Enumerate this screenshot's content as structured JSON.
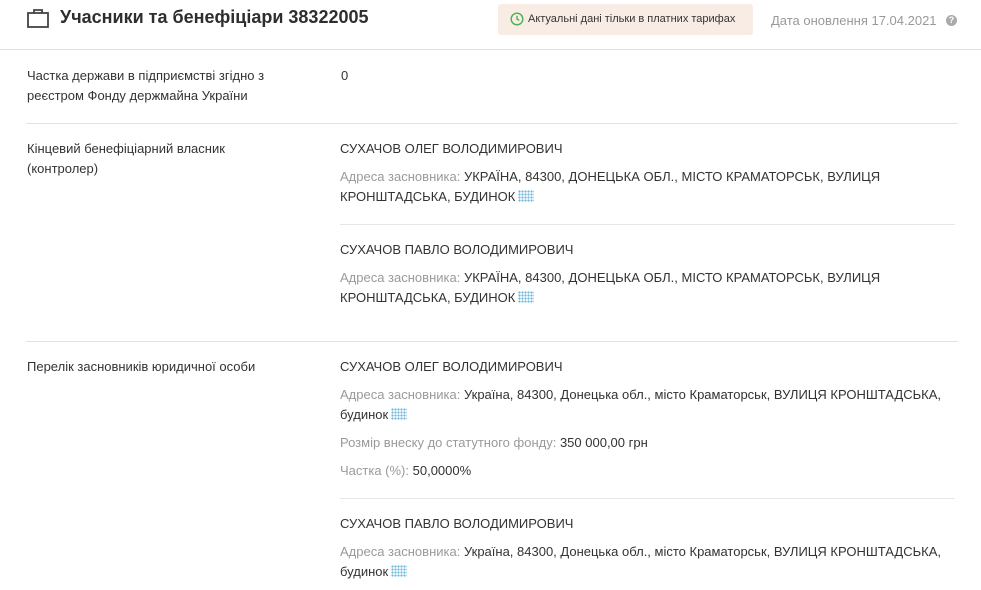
{
  "header": {
    "title": "Учасники та бенефіціари 38322005",
    "notice": "Актуальні дані тільки в платних тарифах",
    "update_date": "Дата оновлення 17.04.2021",
    "help": "?"
  },
  "state_share": {
    "label": "Частка держави в підприємстві згідно з реєстром Фонду держмайна України",
    "value": "0"
  },
  "beneficiaries": {
    "label": "Кінцевий бенефіціарний власник (контролер)",
    "items": [
      {
        "name": "СУХАЧОВ ОЛЕГ ВОЛОДИМИРОВИЧ",
        "address_label": "Адреса засновника:",
        "address": "УКРАЇНА, 84300, ДОНЕЦЬКА ОБЛ., МІСТО КРАМАТОРСЬК, ВУЛИЦЯ КРОНШТАДСЬКА, БУДИНОК"
      },
      {
        "name": "СУХАЧОВ ПАВЛО ВОЛОДИМИРОВИЧ",
        "address_label": "Адреса засновника:",
        "address": "УКРАЇНА, 84300, ДОНЕЦЬКА ОБЛ., МІСТО КРАМАТОРСЬК, ВУЛИЦЯ КРОНШТАДСЬКА, БУДИНОК"
      }
    ]
  },
  "founders": {
    "label": "Перелік засновників юридичної особи",
    "items": [
      {
        "name": "СУХАЧОВ ОЛЕГ ВОЛОДИМИРОВИЧ",
        "address_label": "Адреса засновника:",
        "address": "Україна, 84300, Донецька обл., місто Краматорськ, ВУЛИЦЯ КРОНШТАДСЬКА, будинок",
        "capital_label": "Розмір внеску до статутного фонду:",
        "capital": "350 000,00 грн",
        "share_label": "Частка (%):",
        "share": "50,0000%"
      },
      {
        "name": "СУХАЧОВ ПАВЛО ВОЛОДИМИРОВИЧ",
        "address_label": "Адреса засновника:",
        "address": "Україна, 84300, Донецька обл., місто Краматорськ, ВУЛИЦЯ КРОНШТАДСЬКА, будинок"
      }
    ]
  },
  "icons": [
    "briefcase-icon",
    "clock-icon",
    "help-icon",
    "hidden-data-icon"
  ],
  "colors": {
    "notice_bg": "#f8ece4",
    "notice_icon": "#4caf50",
    "muted": "#9a9a9a"
  }
}
